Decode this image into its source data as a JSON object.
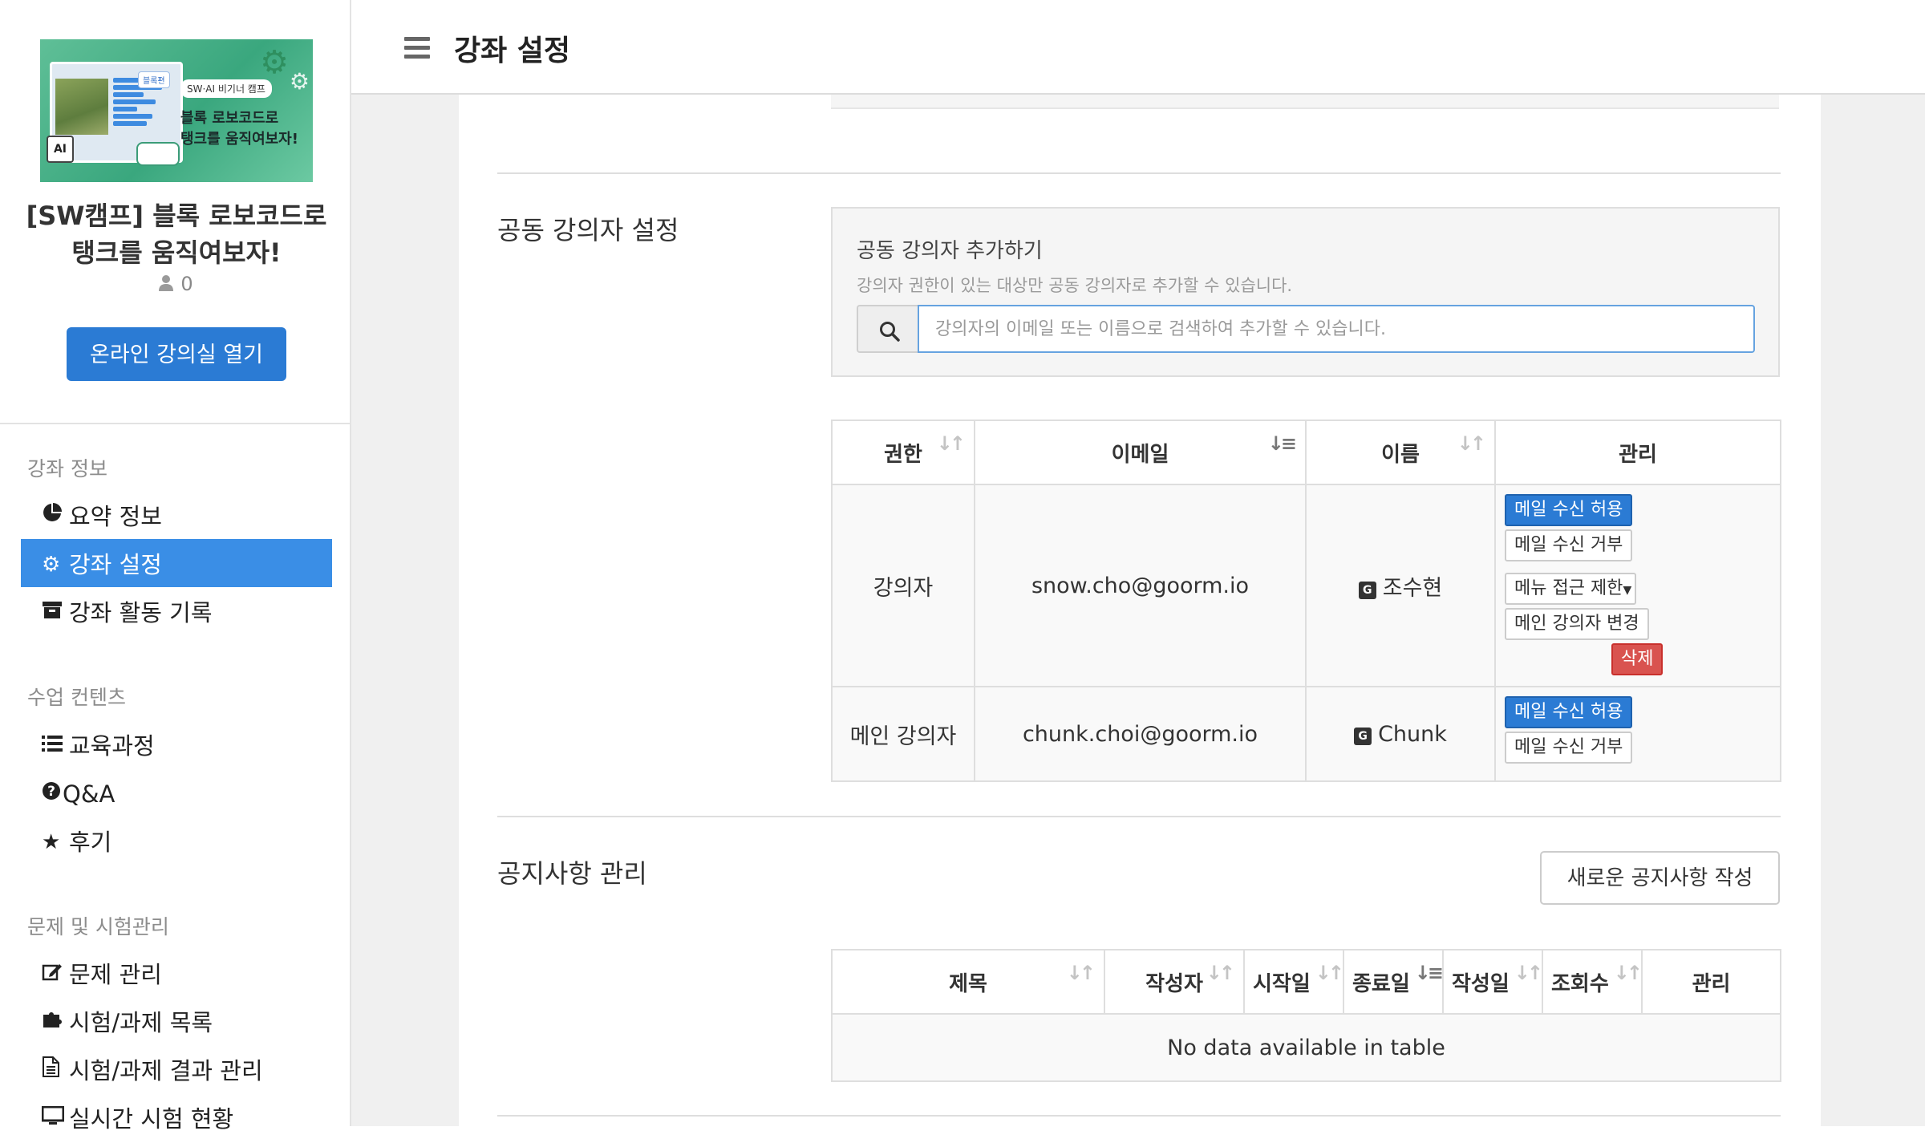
{
  "sidebar": {
    "banner": {
      "tag": "블록편",
      "bubble": "SW·AI 비기너 캠프",
      "line1": "블록 로보코드로",
      "line2": "탱크를 움직여보자!",
      "ai": "AI"
    },
    "course_title": "[SW캠프] 블록 로보코드로 탱크를 움직여보자!",
    "student_count": "0",
    "open_button": "온라인 강의실 열기",
    "sections": [
      {
        "title": "강좌 정보",
        "items": [
          {
            "label": "요약 정보",
            "icon": "pie-chart-icon"
          },
          {
            "label": "강좌 설정",
            "icon": "gears-icon",
            "active": true
          },
          {
            "label": "강좌 활동 기록",
            "icon": "archive-icon"
          }
        ]
      },
      {
        "title": "수업 컨텐츠",
        "items": [
          {
            "label": "교육과정",
            "icon": "list-icon"
          },
          {
            "label": "Q&A",
            "icon": "question-circle-icon"
          },
          {
            "label": "후기",
            "icon": "star-icon"
          }
        ]
      },
      {
        "title": "문제 및 시험관리",
        "items": [
          {
            "label": "문제 관리",
            "icon": "edit-icon"
          },
          {
            "label": "시험/과제 목록",
            "icon": "puzzle-icon"
          },
          {
            "label": "시험/과제 결과 관리",
            "icon": "file-text-icon"
          },
          {
            "label": "실시간 시험 현황",
            "icon": "monitor-icon"
          }
        ]
      }
    ],
    "active_color": "#3a8ee6"
  },
  "header": {
    "title": "강좌 설정"
  },
  "co_instructor": {
    "section_title": "공동 강의자 설정",
    "add_title": "공동 강의자 추가하기",
    "add_help": "강의자 권한이 있는 대상만 공동 강의자로 추가할 수 있습니다.",
    "search_placeholder": "강의자의 이메일 또는 이름으로 검색하여 추가할 수 있습니다.",
    "columns": [
      "권한",
      "이메일",
      "이름",
      "관리"
    ],
    "rows": [
      {
        "role": "강의자",
        "email": "snow.cho@goorm.io",
        "name": "조수현",
        "actions": {
          "allow_mail": "메일 수신 허용",
          "deny_mail": "메일 수신 거부",
          "restrict_menu": "메뉴 접근 제한",
          "change_main": "메인 강의자 변경",
          "delete": "삭제"
        }
      },
      {
        "role": "메인 강의자",
        "email": "chunk.choi@goorm.io",
        "name": "Chunk",
        "actions": {
          "allow_mail": "메일 수신 허용",
          "deny_mail": "메일 수신 거부"
        }
      }
    ]
  },
  "notice": {
    "section_title": "공지사항 관리",
    "new_button": "새로운 공지사항 작성",
    "columns": [
      "제목",
      "작성자",
      "시작일",
      "종료일",
      "작성일",
      "조회수",
      "관리"
    ],
    "empty": "No data available in table"
  },
  "colors": {
    "primary": "#2b7bd4",
    "danger": "#d9534f"
  }
}
